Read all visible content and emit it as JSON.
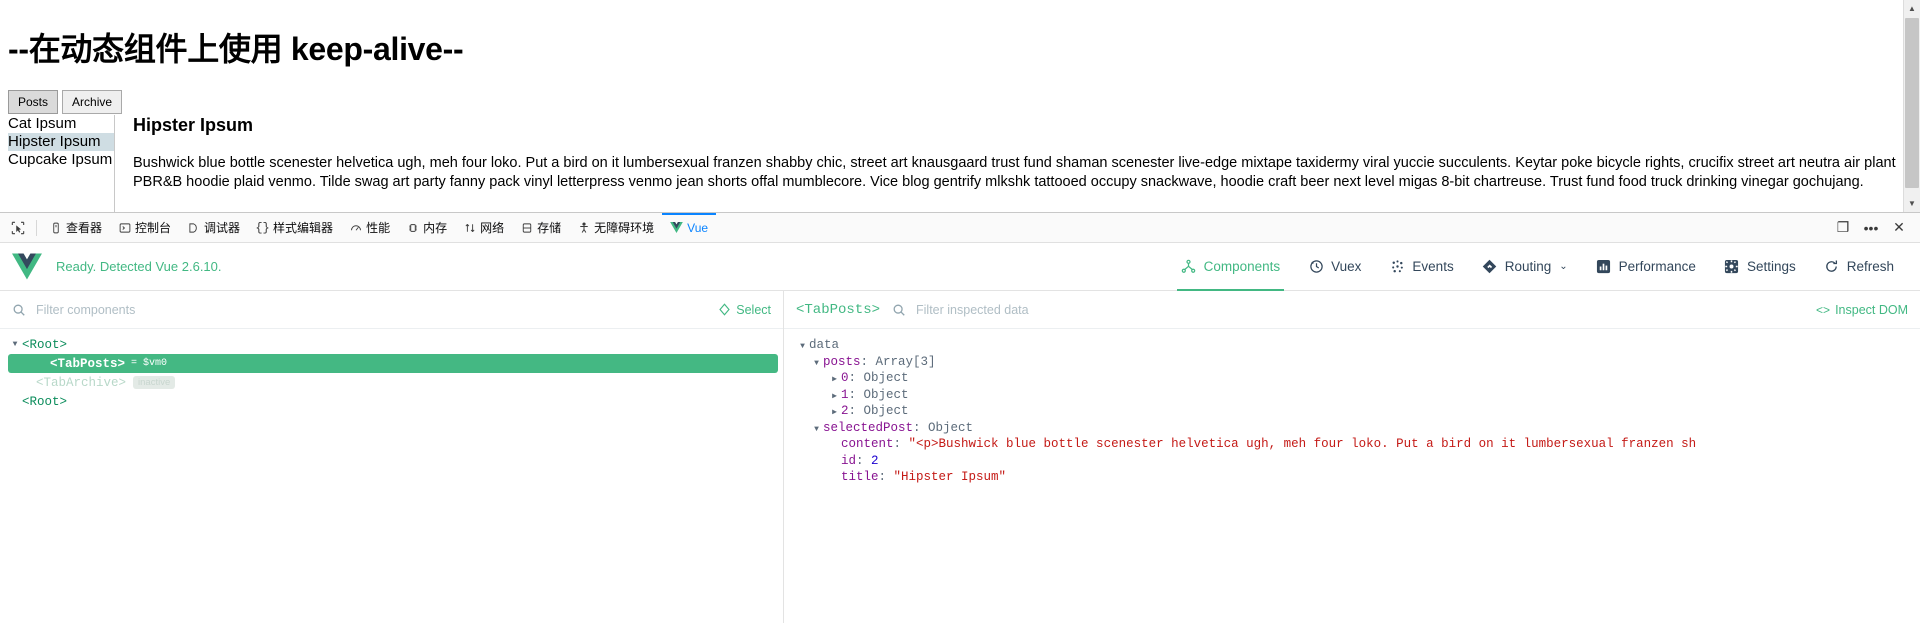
{
  "page": {
    "title": "--在动态组件上使用 keep-alive--",
    "tabs": [
      {
        "label": "Posts",
        "active": true
      },
      {
        "label": "Archive",
        "active": false
      }
    ],
    "posts": [
      {
        "label": "Cat Ipsum",
        "selected": false
      },
      {
        "label": "Hipster Ipsum",
        "selected": true
      },
      {
        "label": "Cupcake Ipsum",
        "selected": false
      }
    ],
    "post_heading": "Hipster Ipsum",
    "post_body": "Bushwick blue bottle scenester helvetica ugh, meh four loko. Put a bird on it lumbersexual franzen shabby chic, street art knausgaard trust fund shaman scenester live-edge mixtape taxidermy viral yuccie succulents. Keytar poke bicycle rights, crucifix street art neutra air plant PBR&B hoodie plaid venmo. Tilde swag art party fanny pack vinyl letterpress venmo jean shorts offal mumblecore. Vice blog gentrify mlkshk tattooed occupy snackwave, hoodie craft beer next level migas 8-bit chartreuse. Trust fund food truck drinking vinegar gochujang."
  },
  "devtools": {
    "picker_icon": "element-picker-icon",
    "tabs": [
      {
        "label": "查看器",
        "icon": "inspector-icon",
        "active": false
      },
      {
        "label": "控制台",
        "icon": "console-icon",
        "active": false
      },
      {
        "label": "调试器",
        "icon": "debugger-icon",
        "active": false
      },
      {
        "label": "样式编辑器",
        "icon": "style-editor-icon",
        "active": false
      },
      {
        "label": "性能",
        "icon": "performance-icon",
        "active": false
      },
      {
        "label": "内存",
        "icon": "memory-icon",
        "active": false
      },
      {
        "label": "网络",
        "icon": "network-icon",
        "active": false
      },
      {
        "label": "存储",
        "icon": "storage-icon",
        "active": false
      },
      {
        "label": "无障碍环境",
        "icon": "accessibility-icon",
        "active": false
      },
      {
        "label": "Vue",
        "icon": "vue-logo-icon",
        "active": true
      }
    ],
    "right_buttons": [
      {
        "name": "responsive-design-mode-icon",
        "glyph": "❐"
      },
      {
        "name": "more-options-icon",
        "glyph": "•••"
      },
      {
        "name": "close-devtools-icon",
        "glyph": "✕"
      }
    ],
    "accent_active": "#0a84ff"
  },
  "vue_panel": {
    "status": "Ready. Detected Vue 2.6.10.",
    "accent": "#42b883",
    "nav": [
      {
        "label": "Components",
        "icon": "components-icon",
        "active": true,
        "caret": false
      },
      {
        "label": "Vuex",
        "icon": "vuex-icon",
        "active": false,
        "caret": false
      },
      {
        "label": "Events",
        "icon": "events-icon",
        "active": false,
        "caret": false
      },
      {
        "label": "Routing",
        "icon": "routing-icon",
        "active": false,
        "caret": true
      },
      {
        "label": "Performance",
        "icon": "performance-bar-icon",
        "active": false,
        "caret": false
      },
      {
        "label": "Settings",
        "icon": "settings-gear-icon",
        "active": false,
        "caret": false
      },
      {
        "label": "Refresh",
        "icon": "refresh-icon",
        "active": false,
        "caret": false
      }
    ],
    "caret_glyph": "⌄",
    "left": {
      "filter_placeholder": "Filter components",
      "filter_value": "",
      "select_label": "Select",
      "tree": [
        {
          "label": "<Root>",
          "depth": 0,
          "arrow": "▼",
          "selected": false,
          "inactive": false,
          "vm": "",
          "badge": ""
        },
        {
          "label": "<TabPosts>",
          "depth": 1,
          "arrow": "",
          "selected": true,
          "inactive": false,
          "vm": "= $vm0",
          "badge": ""
        },
        {
          "label": "<TabArchive>",
          "depth": 1,
          "arrow": "",
          "selected": false,
          "inactive": true,
          "vm": "",
          "badge": "inactive"
        },
        {
          "label": "<Root>",
          "depth": 0,
          "arrow": "",
          "selected": false,
          "inactive": false,
          "vm": "",
          "badge": ""
        }
      ]
    },
    "right": {
      "inspected_component": "<TabPosts>",
      "filter_placeholder": "Filter inspected data",
      "filter_value": "",
      "inspect_dom_label": "Inspect DOM",
      "inspect_dom_icon": "code-brackets-icon",
      "rows": [
        {
          "caret": "▼",
          "depth": 0,
          "key": "data",
          "keyclass": "k-group",
          "sep": "",
          "value": "",
          "valclass": ""
        },
        {
          "caret": "▼",
          "depth": 1,
          "key": "posts",
          "keyclass": "k-name",
          "sep": ":",
          "value": "Array[3]",
          "valclass": "v-type"
        },
        {
          "caret": "▶",
          "depth": 2,
          "key": "0",
          "keyclass": "k-name",
          "sep": ":",
          "value": "Object",
          "valclass": "v-type"
        },
        {
          "caret": "▶",
          "depth": 2,
          "key": "1",
          "keyclass": "k-name",
          "sep": ":",
          "value": "Object",
          "valclass": "v-type"
        },
        {
          "caret": "▶",
          "depth": 2,
          "key": "2",
          "keyclass": "k-name",
          "sep": ":",
          "value": "Object",
          "valclass": "v-type"
        },
        {
          "caret": "▼",
          "depth": 1,
          "key": "selectedPost",
          "keyclass": "k-name",
          "sep": ":",
          "value": "Object",
          "valclass": "v-type"
        },
        {
          "caret": "",
          "depth": 2,
          "key": "content",
          "keyclass": "k-name",
          "sep": ":",
          "value": "\"<p>Bushwick blue bottle scenester helvetica ugh, meh four loko. Put a bird on it lumbersexual franzen sh",
          "valclass": "v-string"
        },
        {
          "caret": "",
          "depth": 2,
          "key": "id",
          "keyclass": "k-name",
          "sep": ":",
          "value": "2",
          "valclass": "v-number"
        },
        {
          "caret": "",
          "depth": 2,
          "key": "title",
          "keyclass": "k-name",
          "sep": ":",
          "value": "\"Hipster Ipsum\"",
          "valclass": "v-string"
        }
      ]
    }
  }
}
